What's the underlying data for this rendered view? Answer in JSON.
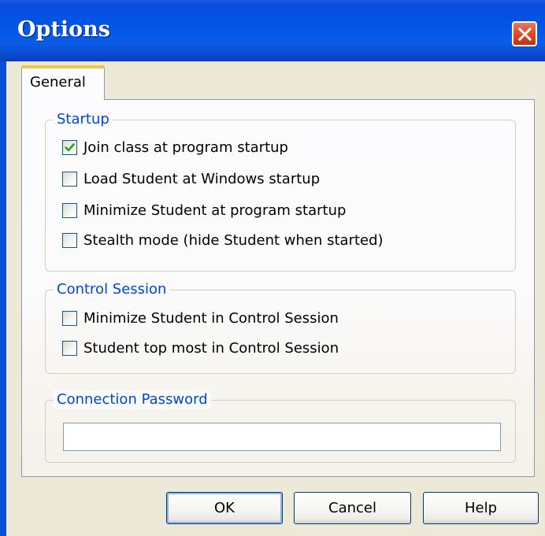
{
  "window": {
    "title": "Options"
  },
  "tabs": [
    {
      "label": "General",
      "selected": true
    }
  ],
  "startup": {
    "legend": "Startup",
    "options": [
      {
        "label": "Join class at program startup",
        "checked": true
      },
      {
        "label": "Load Student at Windows startup",
        "checked": false
      },
      {
        "label": "Minimize Student at program startup",
        "checked": false
      },
      {
        "label": "Stealth mode (hide Student when started)",
        "checked": false
      }
    ]
  },
  "control_session": {
    "legend": "Control Session",
    "options": [
      {
        "label": "Minimize Student in Control Session",
        "checked": false
      },
      {
        "label": "Student top most in Control Session",
        "checked": false
      }
    ]
  },
  "connection_password": {
    "legend": "Connection Password",
    "value": ""
  },
  "buttons": {
    "ok": "OK",
    "cancel": "Cancel",
    "help": "Help"
  },
  "colors": {
    "titlebar": "#0054E3",
    "legend_text": "#0046D5",
    "checkmark": "#21A121",
    "close_button": "#D84A2A",
    "tab_highlight": "#F1C34B"
  }
}
